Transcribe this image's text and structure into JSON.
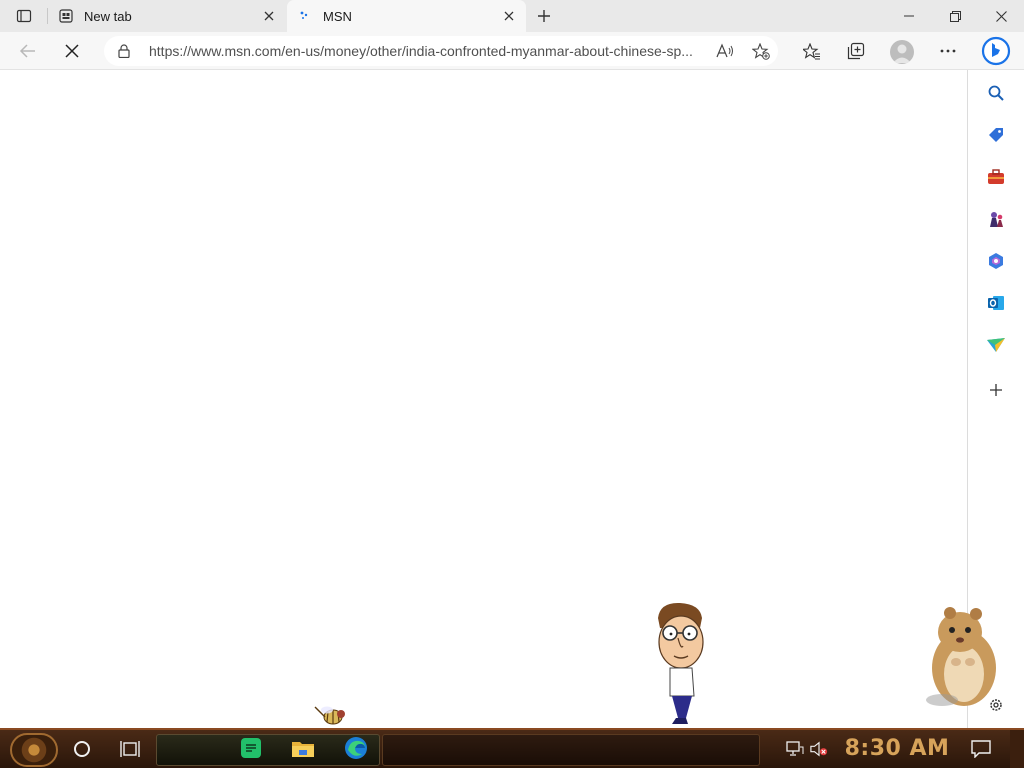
{
  "browser": {
    "tabs": [
      {
        "title": "New tab",
        "favicon": "new-tab-icon",
        "active": false
      },
      {
        "title": "MSN",
        "favicon": "msn-loading-icon",
        "active": true
      }
    ],
    "address_bar": {
      "url": "https://www.msn.com/en-us/money/other/india-confronted-myanmar-about-chinese-sp..."
    },
    "toolbar_icons": [
      "back-icon",
      "stop-loading-icon",
      "lock-icon",
      "read-aloud-icon",
      "add-favorite-icon",
      "favorites-icon",
      "collections-icon",
      "profile-icon",
      "more-icon",
      "bing-icon"
    ],
    "sidebar_icons": [
      "search-icon",
      "shopping-icon",
      "tools-icon",
      "games-icon",
      "office-icon",
      "outlook-icon",
      "send-icon",
      "add-icon"
    ]
  },
  "taskbar": {
    "clock": "8:30 AM",
    "apps": [
      "notes-app-icon",
      "file-explorer-icon",
      "edge-icon"
    ]
  },
  "colors": {
    "tabstrip": "#e9e9e9",
    "toolbar": "#f7f7f7",
    "taskbar": "#3a1f0b",
    "clock": "#d7a35a",
    "bing_blue": "#1a73e8"
  }
}
